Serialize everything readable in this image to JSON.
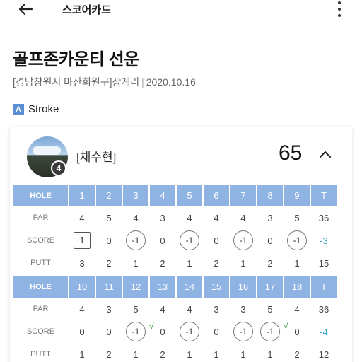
{
  "app": {
    "title": "스코어카드"
  },
  "round": {
    "course": "골프존카운티 선운",
    "location": "[경남창원시 마산회원구]상게리",
    "separator": "|",
    "date": "2020.10.16",
    "mode_badge": "A",
    "mode": "Stroke"
  },
  "player": {
    "name": "[채수현]",
    "handicap_label": "4",
    "total": "65"
  },
  "card": {
    "front": {
      "hole_label": "HOLE",
      "holes": [
        "1",
        "2",
        "3",
        "4",
        "5",
        "6",
        "7",
        "8",
        "9",
        "T"
      ],
      "par_label": "PAR",
      "par": [
        "4",
        "5",
        "4",
        "3",
        "4",
        "4",
        "4",
        "3",
        "5",
        "36"
      ],
      "score_label": "SCORE",
      "score": [
        "1",
        "0",
        "-1",
        "0",
        "-1",
        "0",
        "-1",
        "0",
        "-1",
        "-3"
      ],
      "score_marks": [
        "box",
        "",
        "circle",
        "",
        "circle",
        "",
        "circle",
        "",
        "circle",
        "total"
      ],
      "putt_label": "PUTT",
      "putt": [
        "3",
        "2",
        "1",
        "2",
        "1",
        "2",
        "1",
        "2",
        "1",
        "15"
      ]
    },
    "back": {
      "hole_label": "HOLE",
      "holes": [
        "10",
        "11",
        "12",
        "13",
        "14",
        "15",
        "16",
        "17",
        "18",
        "T"
      ],
      "par_label": "PAR",
      "par": [
        "4",
        "3",
        "5",
        "4",
        "4",
        "3",
        "3",
        "5",
        "4",
        "36"
      ],
      "score_label": "SCORE",
      "score": [
        "0",
        "0",
        "-1",
        "0",
        "-1",
        "0",
        "-1",
        "-1",
        "0",
        "-4"
      ],
      "score_marks": [
        "",
        "",
        "circle",
        "check",
        "circle",
        "",
        "circle",
        "circle",
        "check",
        "total"
      ],
      "check_mark": "√",
      "putt_label": "PUTT",
      "putt": [
        "1",
        "2",
        "1",
        "2",
        "1",
        "1",
        "1",
        "1",
        "2",
        "12"
      ]
    }
  }
}
